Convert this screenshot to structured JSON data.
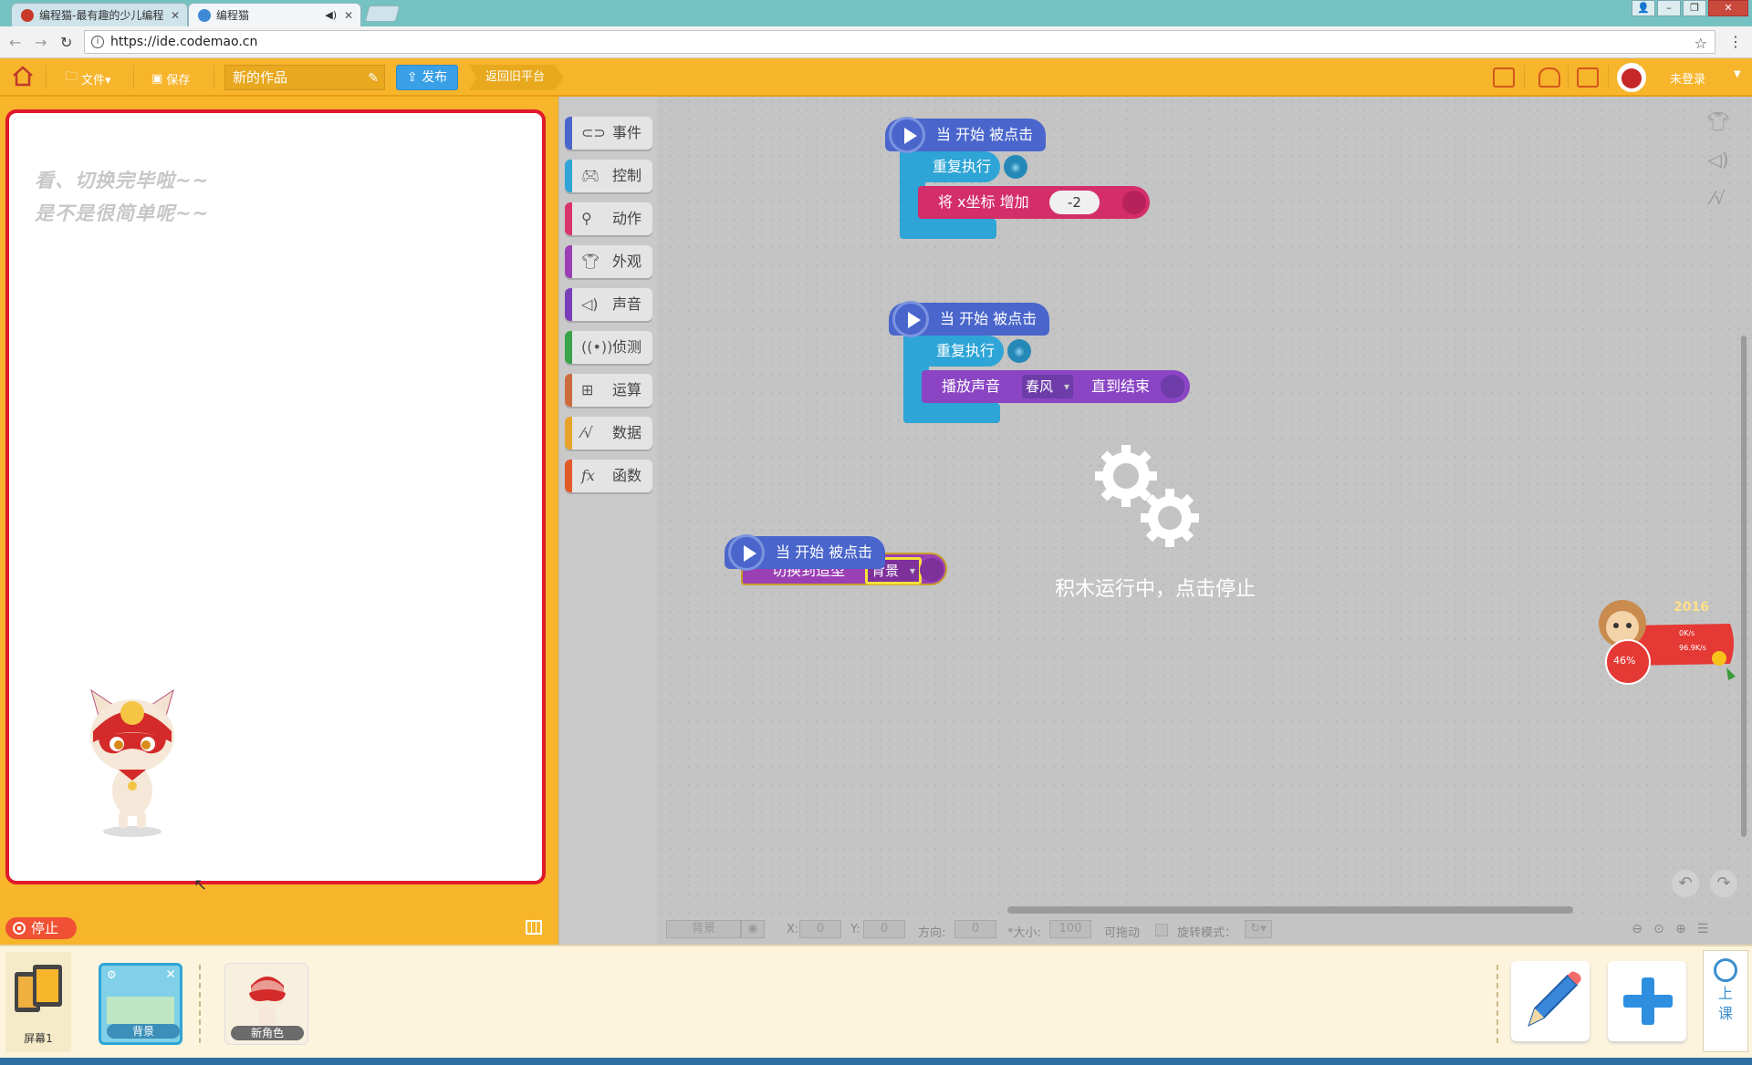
{
  "browser": {
    "tabs": [
      {
        "title": "编程猫-最有趣的少儿编程",
        "active": false
      },
      {
        "title": "编程猫",
        "active": true
      }
    ],
    "url": "https://ide.codemao.cn"
  },
  "toolbar": {
    "file_label": "文件▾",
    "save_label": "保存",
    "project_name": "新的作品",
    "publish_label": "发布",
    "back_label": "返回旧平台",
    "login_label": "未登录"
  },
  "stage": {
    "text_line1": "看、切换完毕啦~~",
    "text_line2": "是不是很简单呢~~",
    "stop_label": "停止"
  },
  "categories": [
    {
      "label": "事件",
      "icon": "toggle-icon",
      "color": "#4a66cc"
    },
    {
      "label": "控制",
      "icon": "gamepad-icon",
      "color": "#2ea5d6"
    },
    {
      "label": "动作",
      "icon": "runner-icon",
      "color": "#d9346b"
    },
    {
      "label": "外观",
      "icon": "shirt-icon",
      "color": "#9b3fb4"
    },
    {
      "label": "声音",
      "icon": "speaker-icon",
      "color": "#7a3fb8"
    },
    {
      "label": "侦测",
      "icon": "sensor-icon",
      "color": "#39a34a"
    },
    {
      "label": "运算",
      "icon": "calculator-icon",
      "color": "#cc6b3b"
    },
    {
      "label": "数据",
      "icon": "chart-icon",
      "color": "#e6a32b"
    },
    {
      "label": "函数",
      "icon": "function-icon",
      "color": "#e05a28"
    }
  ],
  "scripts": {
    "s1": {
      "hat": "当 开始 被点击",
      "loop": "重复执行",
      "action": "将 x坐标 增加",
      "value": "-2"
    },
    "s2": {
      "hat": "当 开始 被点击",
      "loop": "重复执行",
      "play": "播放声音",
      "sound": "春风",
      "until": "直到结束"
    },
    "s3": {
      "hat": "当 开始 被点击",
      "switch": "切换到造型",
      "costume": "背景"
    }
  },
  "running_text": "积木运行中，点击停止",
  "props": {
    "sprite_name": "背景",
    "x_label": "X:",
    "x_value": "0",
    "y_label": "Y:",
    "y_value": "0",
    "dir_label": "方向:",
    "dir_value": "0",
    "size_label": "*大小:",
    "size_value": "100",
    "draggable_label": "可拖动",
    "rotate_label": "旋转模式："
  },
  "monkey_widget": {
    "year": "2016",
    "percent": "46%",
    "up": "0K/s",
    "down": "96.9K/s"
  },
  "bottom": {
    "screen_label": "屏幕1",
    "sprites": [
      {
        "label": "背景",
        "selected": true
      },
      {
        "label": "新角色",
        "selected": false
      }
    ],
    "class_label": "上课"
  }
}
